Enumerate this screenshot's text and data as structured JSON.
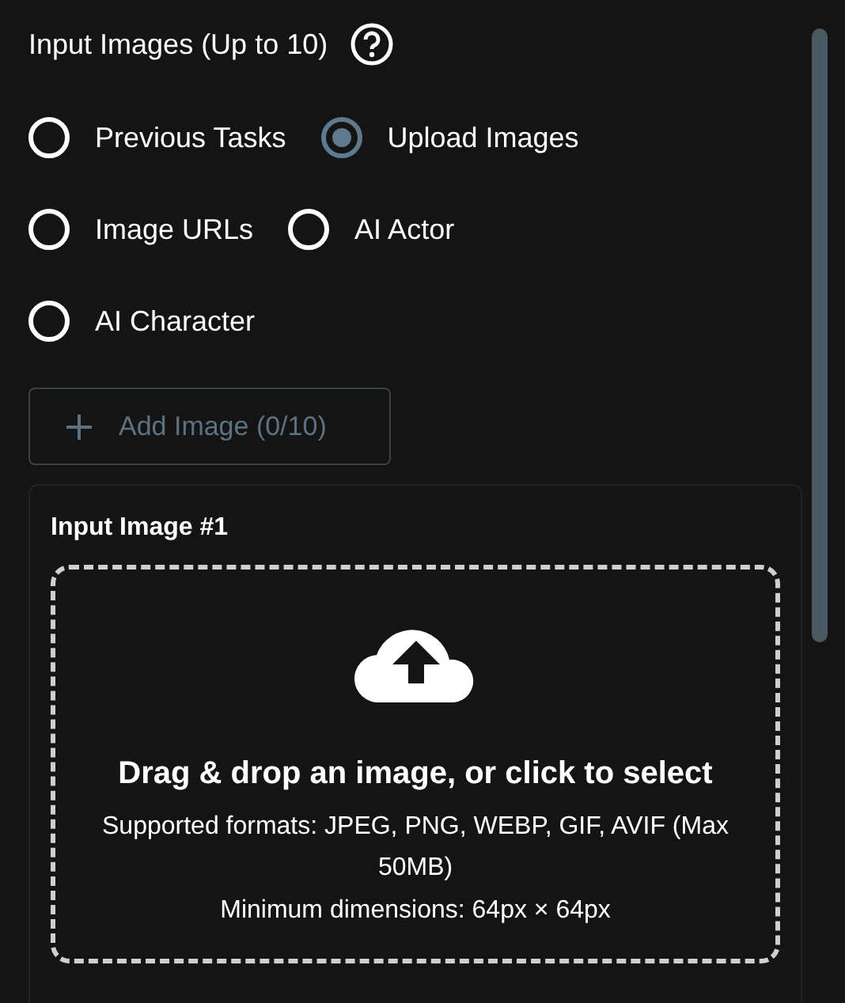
{
  "title": "Input Images (Up to 10)",
  "source_options": [
    {
      "label": "Previous Tasks",
      "selected": false
    },
    {
      "label": "Upload Images",
      "selected": true
    },
    {
      "label": "Image URLs",
      "selected": false
    },
    {
      "label": "AI Actor",
      "selected": false
    },
    {
      "label": "AI Character",
      "selected": false
    }
  ],
  "add_button": {
    "label": "Add Image (0/10)",
    "disabled": true
  },
  "image_card": {
    "title": "Input Image #1",
    "dropzone": {
      "heading": "Drag & drop an image, or click to select",
      "formats": "Supported formats: JPEG, PNG, WEBP, GIF, AVIF (Max 50MB)",
      "dimensions": "Minimum dimensions: 64px × 64px"
    }
  }
}
